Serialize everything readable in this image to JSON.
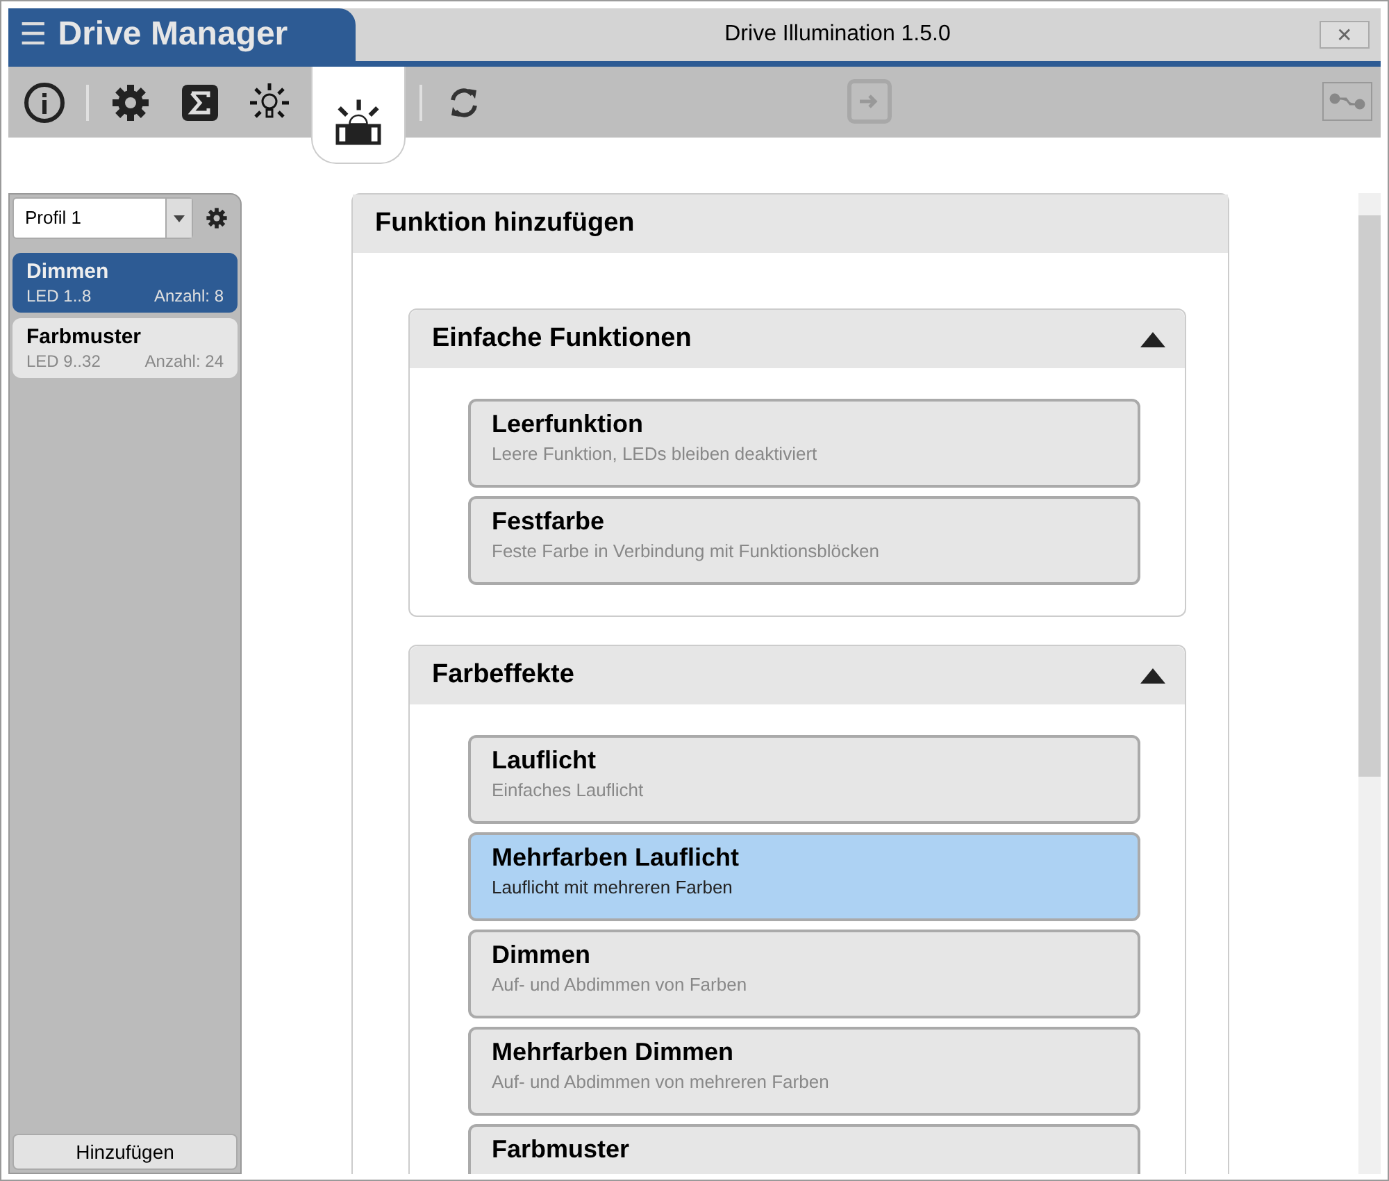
{
  "app": {
    "menu_glyph": "☰",
    "name": "Drive Manager"
  },
  "window": {
    "title": "Drive Illumination 1.5.0",
    "close_glyph": "✕"
  },
  "toolbar": {
    "tools": [
      {
        "kind": "info",
        "selected": false
      },
      {
        "kind": "gear",
        "selected": false
      },
      {
        "kind": "sigma",
        "selected": false
      },
      {
        "kind": "bulb",
        "selected": false
      },
      {
        "kind": "lightbar",
        "selected": true
      },
      {
        "kind": "refresh",
        "selected": false
      }
    ],
    "transfer": {
      "disabled": true
    },
    "connection": {
      "disabled": true
    }
  },
  "sidebar": {
    "profile": {
      "value": "Profil 1"
    },
    "items": [
      {
        "title": "Dimmen",
        "range": "LED 1..8",
        "count": "Anzahl: 8",
        "selected": true
      },
      {
        "title": "Farbmuster",
        "range": "LED 9..32",
        "count": "Anzahl: 24",
        "selected": false
      }
    ],
    "add_button": "Hinzufügen"
  },
  "panel": {
    "title": "Funktion hinzufügen",
    "sections": [
      {
        "title": "Einfache Funktionen",
        "expanded": true,
        "items": [
          {
            "title": "Leerfunktion",
            "description": "Leere Funktion, LEDs bleiben deaktiviert",
            "selected": false
          },
          {
            "title": "Festfarbe",
            "description": "Feste Farbe in Verbindung mit Funktionsblöcken",
            "selected": false
          }
        ]
      },
      {
        "title": "Farbeffekte",
        "expanded": true,
        "items": [
          {
            "title": "Lauflicht",
            "description": "Einfaches Lauflicht",
            "selected": false
          },
          {
            "title": "Mehrfarben Lauflicht",
            "description": "Lauflicht mit mehreren Farben",
            "selected": true
          },
          {
            "title": "Dimmen",
            "description": "Auf- und Abdimmen von Farben",
            "selected": false
          },
          {
            "title": "Mehrfarben Dimmen",
            "description": "Auf- und Abdimmen von mehreren Farben",
            "selected": false
          },
          {
            "title": "Farbmuster",
            "selected": false
          }
        ]
      }
    ]
  }
}
